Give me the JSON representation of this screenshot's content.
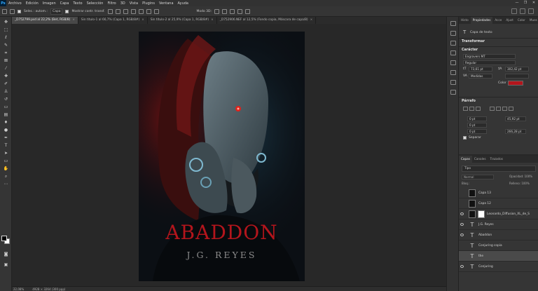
{
  "menubar": {
    "logo": "Ps",
    "items": [
      "Archivo",
      "Edición",
      "Imagen",
      "Capa",
      "Texto",
      "Selección",
      "Filtro",
      "3D",
      "Vista",
      "Plugins",
      "Ventana",
      "Ayuda"
    ],
    "window_controls": [
      "—",
      "❐",
      "✕"
    ]
  },
  "options": {
    "select_label": "Selec.: autom.:",
    "select_value": "Capa",
    "show_transform": "Mostrar contr. transf.",
    "mode_label": "Modo 3D:"
  },
  "tabs": [
    {
      "label": "_D752799.psd al 22,2% (Bet, RGB/8)",
      "active": true
    },
    {
      "label": "Sin título-1 al 66,7% (Capa 1, RGB/8#)",
      "active": false
    },
    {
      "label": "Sin título-2 al 25,9% (Capa 1, RGB/8#)",
      "active": false
    },
    {
      "label": "_D752906.NEF al 12,5% (Fondo copia, Máscara de capa/8)",
      "active": false
    }
  ],
  "poster": {
    "title": "ABADDON",
    "author": "J.G. REYES",
    "title_color": "#b3151c"
  },
  "status": {
    "zoom": "22,08%",
    "doc": "4928 × 3264 (300 ppp)"
  },
  "properties": {
    "tabs": [
      "Histo",
      "Propiedades",
      "Acce",
      "Ajust",
      "Color",
      "Mues"
    ],
    "layer_kind": "Capa de texto",
    "transform_label": "Transformar",
    "char_label": "Carácter",
    "font_family": "Engravers MT",
    "font_style": "Regular",
    "size": "73,61 pt",
    "leading": "302,42 pt",
    "kerning": "Medidas",
    "color_label": "Color",
    "paragraph_label": "Párrafo",
    "indent_left": "0 pt",
    "indent_right": "0 pt",
    "first_line": "0 pt",
    "space_before": "45,92 pt",
    "space_after": "266,28 pt",
    "hyphenate": "Separar"
  },
  "layers": {
    "tabs": [
      "Capas",
      "Canales",
      "Trazados"
    ],
    "filter": "Tipo",
    "mode": "Normal",
    "opacity_label": "Opacidad: 100%",
    "lock_label": "Bloq.:",
    "fill_label": "Relleno: 100%",
    "items": [
      {
        "name": "Capa 13",
        "type": "image",
        "visible": false,
        "selected": false
      },
      {
        "name": "Capa 12",
        "type": "image",
        "visible": false,
        "selected": false
      },
      {
        "name": "Leonardo_Diffusion_XL_de_S",
        "type": "masked",
        "visible": true,
        "selected": false
      },
      {
        "name": "J.G. Reyes",
        "type": "text",
        "visible": true,
        "selected": false
      },
      {
        "name": "Abaddon",
        "type": "text",
        "visible": true,
        "selected": false
      },
      {
        "name": "Conjuring copia",
        "type": "text",
        "visible": false,
        "selected": false
      },
      {
        "name": "the",
        "type": "text",
        "visible": false,
        "selected": true
      },
      {
        "name": "Conjuring",
        "type": "text",
        "visible": true,
        "selected": false
      }
    ]
  }
}
